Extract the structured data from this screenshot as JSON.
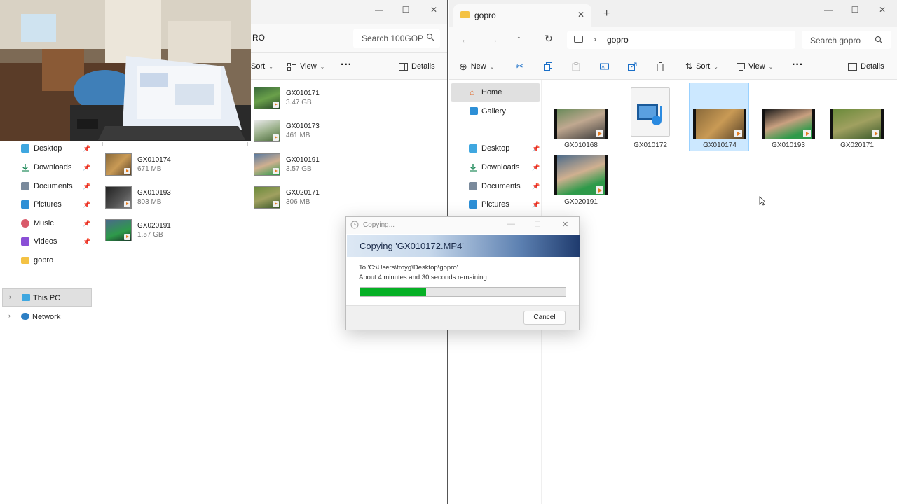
{
  "left_window": {
    "address_fragment": "RO",
    "search_placeholder": "Search 100GOP",
    "command_bar": {
      "sort": "Sort",
      "view": "View",
      "details": "Details"
    },
    "nav_items": [
      {
        "label": "Desktop",
        "pinned": true,
        "icon": "desktop-icon"
      },
      {
        "label": "Downloads",
        "pinned": true,
        "icon": "download-icon"
      },
      {
        "label": "Documents",
        "pinned": true,
        "icon": "document-icon"
      },
      {
        "label": "Pictures",
        "pinned": true,
        "icon": "pictures-icon"
      },
      {
        "label": "Music",
        "pinned": true,
        "icon": "music-icon"
      },
      {
        "label": "Videos",
        "pinned": true,
        "icon": "videos-icon"
      },
      {
        "label": "gopro",
        "pinned": false,
        "icon": "folder-icon"
      }
    ],
    "this_pc": "This PC",
    "network": "Network",
    "files_col1": [
      {
        "name": "GX010174",
        "size": "671 MB"
      },
      {
        "name": "GX010193",
        "size": "803 MB"
      },
      {
        "name": "GX020191",
        "size": "1.57 GB"
      }
    ],
    "files_col2": [
      {
        "name": "GX010171",
        "size": "3.47 GB"
      },
      {
        "name": "GX010173",
        "size": "461 MB"
      },
      {
        "name": "GX010191",
        "size": "3.57 GB"
      },
      {
        "name": "GX020171",
        "size": "306 MB"
      }
    ]
  },
  "right_window": {
    "tab_title": "gopro",
    "breadcrumb": "gopro",
    "search_placeholder": "Search gopro",
    "command_bar": {
      "new": "New",
      "sort": "Sort",
      "view": "View",
      "details": "Details"
    },
    "nav_items": [
      {
        "label": "Home",
        "selected": true,
        "icon": "home-icon"
      },
      {
        "label": "Gallery",
        "selected": false,
        "icon": "gallery-icon"
      },
      {
        "label": "Desktop",
        "pinned": true,
        "icon": "desktop-icon"
      },
      {
        "label": "Downloads",
        "pinned": true,
        "icon": "download-icon"
      },
      {
        "label": "Documents",
        "pinned": true,
        "icon": "document-icon"
      },
      {
        "label": "Pictures",
        "pinned": true,
        "icon": "pictures-icon"
      }
    ],
    "tiles": [
      {
        "name": "GX010168",
        "kind": "video",
        "selected": false
      },
      {
        "name": "GX010172",
        "kind": "media-file",
        "selected": false
      },
      {
        "name": "GX010174",
        "kind": "video",
        "selected": true
      },
      {
        "name": "GX010193",
        "kind": "video",
        "selected": false
      },
      {
        "name": "GX020171",
        "kind": "video",
        "selected": false
      },
      {
        "name": "GX020191",
        "kind": "video",
        "selected": false
      }
    ]
  },
  "copy_dialog": {
    "title": "Copying...",
    "heading": "Copying 'GX010172.MP4'",
    "destination": "To 'C:\\Users\\troyg\\Desktop\\gopro'",
    "time_remaining": "About 4 minutes and 30 seconds remaining",
    "progress_fraction": 0.32,
    "cancel_label": "Cancel"
  },
  "colors": {
    "accent": "#0067c0",
    "progress": "#06b025",
    "selection": "#cce8ff",
    "folder": "#f4c244"
  }
}
